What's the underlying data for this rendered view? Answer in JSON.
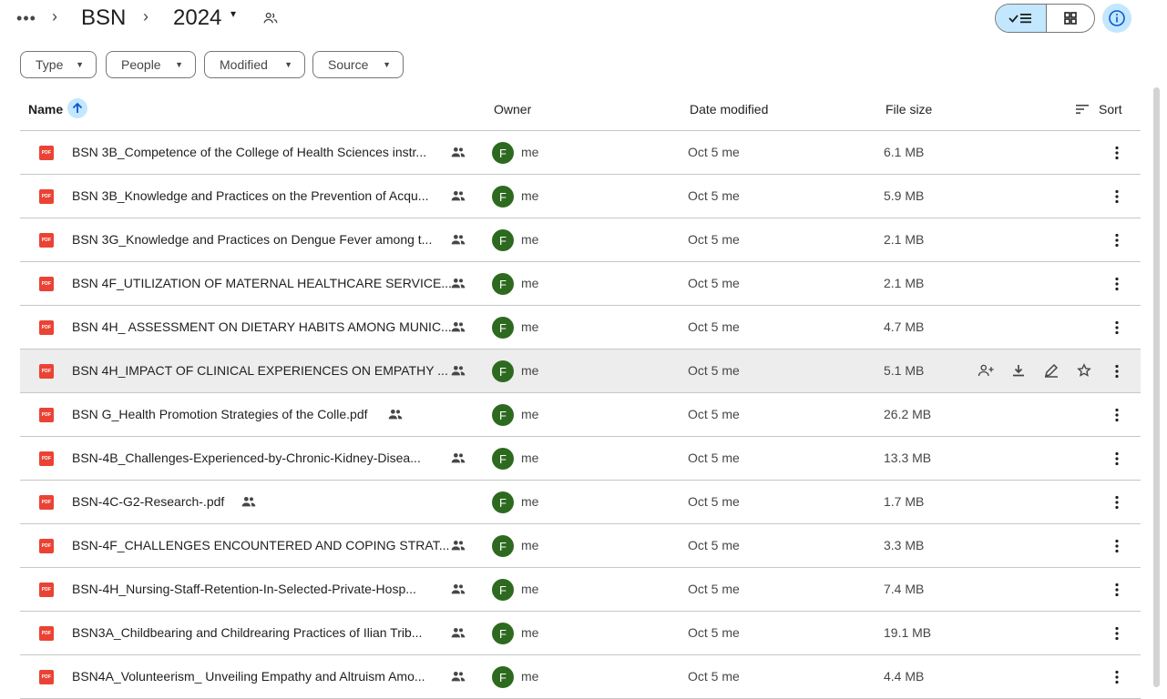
{
  "breadcrumb": {
    "more": "•••",
    "sep": "›",
    "parent": "BSN",
    "current": "2024",
    "caret": "▾",
    "shared_icon": "people-icon"
  },
  "view": {
    "list_icon": "list-view-icon",
    "grid_icon": "grid-view-icon",
    "info_icon": "info-icon"
  },
  "filters": [
    {
      "label": "Type"
    },
    {
      "label": "People"
    },
    {
      "label": "Modified"
    },
    {
      "label": "Source"
    }
  ],
  "columns": {
    "name": "Name",
    "owner": "Owner",
    "date": "Date modified",
    "size": "File size",
    "sort": "Sort"
  },
  "files": [
    {
      "name": "BSN 3B_Competence of the College of Health Sciences instr...",
      "owner": "me",
      "date": "Oct 5 me",
      "size": "6.1 MB",
      "avatar": "F"
    },
    {
      "name": "BSN 3B_Knowledge and Practices on the Prevention of Acqu...",
      "owner": "me",
      "date": "Oct 5 me",
      "size": "5.9 MB",
      "avatar": "F"
    },
    {
      "name": "BSN 3G_Knowledge and Practices on Dengue Fever among t...",
      "owner": "me",
      "date": "Oct 5 me",
      "size": "2.1 MB",
      "avatar": "F"
    },
    {
      "name": "BSN 4F_UTILIZATION OF MATERNAL HEALTHCARE SERVICE...",
      "owner": "me",
      "date": "Oct 5 me",
      "size": "2.1 MB",
      "avatar": "F"
    },
    {
      "name": "BSN 4H_ ASSESSMENT ON DIETARY HABITS AMONG MUNIC...",
      "owner": "me",
      "date": "Oct 5 me",
      "size": "4.7 MB",
      "avatar": "F"
    },
    {
      "name": "BSN 4H_IMPACT OF CLINICAL EXPERIENCES ON EMPATHY ...",
      "owner": "me",
      "date": "Oct 5 me",
      "size": "5.1 MB",
      "avatar": "F"
    },
    {
      "name": "BSN G_Health Promotion Strategies of the Colle.pdf",
      "owner": "me",
      "date": "Oct 5 me",
      "size": "26.2 MB",
      "avatar": "F"
    },
    {
      "name": "BSN-4B_Challenges-Experienced-by-Chronic-Kidney-Disea...",
      "owner": "me",
      "date": "Oct 5 me",
      "size": "13.3 MB",
      "avatar": "F"
    },
    {
      "name": "BSN-4C-G2-Research-.pdf",
      "owner": "me",
      "date": "Oct 5 me",
      "size": "1.7 MB",
      "avatar": "F"
    },
    {
      "name": "BSN-4F_CHALLENGES ENCOUNTERED AND COPING STRAT...",
      "owner": "me",
      "date": "Oct 5 me",
      "size": "3.3 MB",
      "avatar": "F"
    },
    {
      "name": "BSN-4H_Nursing-Staff-Retention-In-Selected-Private-Hosp...",
      "owner": "me",
      "date": "Oct 5 me",
      "size": "7.4 MB",
      "avatar": "F"
    },
    {
      "name": "BSN3A_Childbearing and Childrearing Practices of Ilian Trib...",
      "owner": "me",
      "date": "Oct 5 me",
      "size": "19.1 MB",
      "avatar": "F"
    },
    {
      "name": "BSN4A_Volunteerism_ Unveiling Empathy and Altruism Amo...",
      "owner": "me",
      "date": "Oct 5 me",
      "size": "4.4 MB",
      "avatar": "F"
    }
  ],
  "pdf_badge": "PDF",
  "colors": {
    "accent": "#c2e7ff",
    "pdf": "#ea4335",
    "avatar": "#2d6a1f",
    "hover_row": "#ededed"
  }
}
